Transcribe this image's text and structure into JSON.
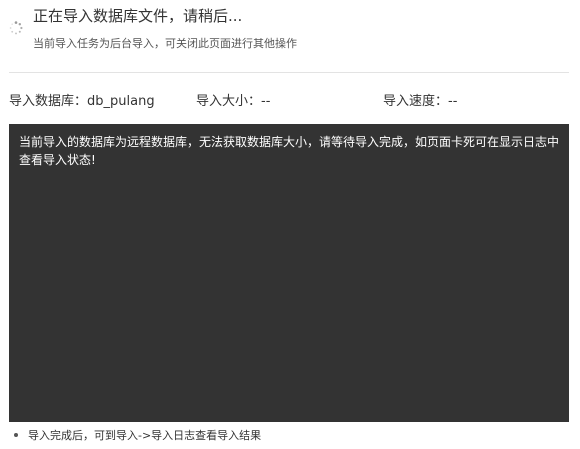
{
  "header": {
    "title": "正在导入数据库文件，请稍后...",
    "subtitle": "当前导入任务为后台导入，可关闭此页面进行其他操作",
    "spinner_icon": "loading-spinner-icon"
  },
  "info": {
    "database": "导入数据库：db_pulang",
    "size": "导入大小：--",
    "speed": "导入速度：--"
  },
  "log": {
    "message": "当前导入的数据库为远程数据库，无法获取数据库大小，请等待导入完成，如页面卡死可在显示日志中查看导入状态!"
  },
  "notes": [
    "导入完成后，可到导入->导入日志查看导入结果"
  ],
  "colors": {
    "log_background": "#333333",
    "log_text": "#ffffff",
    "divider": "#e3e3e3"
  }
}
